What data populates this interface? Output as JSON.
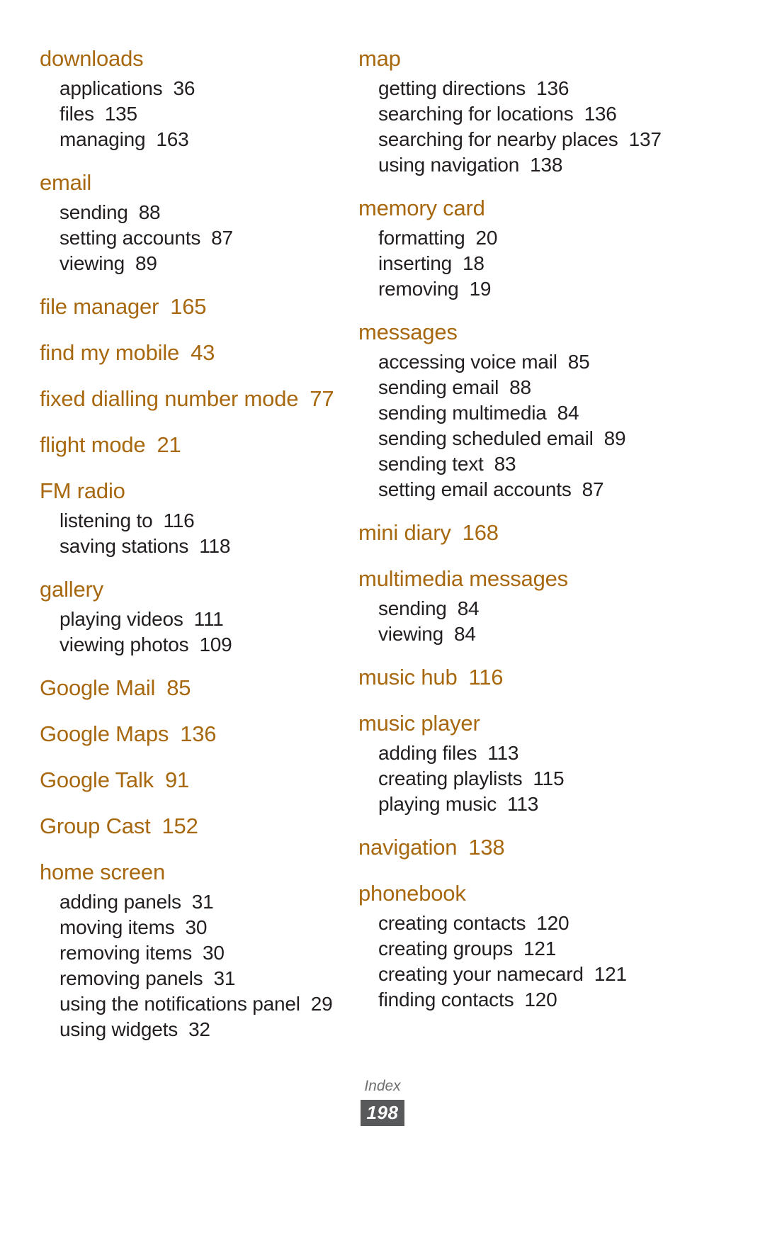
{
  "document": {
    "type": "index-page",
    "heading_color": "#a8680f",
    "body_color": "#231f20",
    "background": "#ffffff"
  },
  "footer": {
    "label": "Index",
    "page_number": "198",
    "badge_color": "#58595b",
    "label_color": "#6d6e70"
  },
  "columns": [
    {
      "name": "left-column",
      "groups": [
        {
          "heading": "downloads",
          "heading_page": "",
          "entries": [
            {
              "label": "applications",
              "page": "36"
            },
            {
              "label": "files",
              "page": "135"
            },
            {
              "label": "managing",
              "page": "163"
            }
          ]
        },
        {
          "heading": "email",
          "heading_page": "",
          "entries": [
            {
              "label": "sending",
              "page": "88"
            },
            {
              "label": "setting accounts",
              "page": "87"
            },
            {
              "label": "viewing",
              "page": "89"
            }
          ]
        },
        {
          "heading": "file manager",
          "heading_page": "165",
          "entries": []
        },
        {
          "heading": "find my mobile",
          "heading_page": "43",
          "entries": []
        },
        {
          "heading": "fixed dialling number mode",
          "heading_page": "77",
          "entries": []
        },
        {
          "heading": "flight mode",
          "heading_page": "21",
          "entries": []
        },
        {
          "heading": "FM radio",
          "heading_page": "",
          "entries": [
            {
              "label": "listening to",
              "page": "116"
            },
            {
              "label": "saving stations",
              "page": "118"
            }
          ]
        },
        {
          "heading": "gallery",
          "heading_page": "",
          "entries": [
            {
              "label": "playing videos",
              "page": "111"
            },
            {
              "label": "viewing photos",
              "page": "109"
            }
          ]
        },
        {
          "heading": "Google Mail",
          "heading_page": "85",
          "entries": []
        },
        {
          "heading": "Google Maps",
          "heading_page": "136",
          "entries": []
        },
        {
          "heading": "Google Talk",
          "heading_page": "91",
          "entries": []
        },
        {
          "heading": "Group Cast",
          "heading_page": "152",
          "entries": []
        },
        {
          "heading": "home screen",
          "heading_page": "",
          "entries": [
            {
              "label": "adding panels",
              "page": "31"
            },
            {
              "label": "moving items",
              "page": "30"
            },
            {
              "label": "removing items",
              "page": "30"
            },
            {
              "label": "removing panels",
              "page": "31"
            },
            {
              "label": "using the notifications panel",
              "page": "29"
            },
            {
              "label": "using widgets",
              "page": "32"
            }
          ]
        }
      ]
    },
    {
      "name": "right-column",
      "groups": [
        {
          "heading": "map",
          "heading_page": "",
          "entries": [
            {
              "label": "getting directions",
              "page": "136"
            },
            {
              "label": "searching for locations",
              "page": "136"
            },
            {
              "label": "searching for nearby places",
              "page": "137"
            },
            {
              "label": "using navigation",
              "page": "138"
            }
          ]
        },
        {
          "heading": "memory card",
          "heading_page": "",
          "entries": [
            {
              "label": "formatting",
              "page": "20"
            },
            {
              "label": "inserting",
              "page": "18"
            },
            {
              "label": "removing",
              "page": "19"
            }
          ]
        },
        {
          "heading": "messages",
          "heading_page": "",
          "entries": [
            {
              "label": "accessing voice mail",
              "page": "85"
            },
            {
              "label": "sending email",
              "page": "88"
            },
            {
              "label": "sending multimedia",
              "page": "84"
            },
            {
              "label": "sending scheduled email",
              "page": "89"
            },
            {
              "label": "sending text",
              "page": "83"
            },
            {
              "label": "setting email accounts",
              "page": "87"
            }
          ]
        },
        {
          "heading": "mini diary",
          "heading_page": "168",
          "entries": []
        },
        {
          "heading": "multimedia messages",
          "heading_page": "",
          "entries": [
            {
              "label": "sending",
              "page": "84"
            },
            {
              "label": "viewing",
              "page": "84"
            }
          ]
        },
        {
          "heading": "music hub",
          "heading_page": "116",
          "entries": []
        },
        {
          "heading": "music player",
          "heading_page": "",
          "entries": [
            {
              "label": "adding files",
              "page": "113"
            },
            {
              "label": "creating playlists",
              "page": "115"
            },
            {
              "label": "playing music",
              "page": "113"
            }
          ]
        },
        {
          "heading": "navigation",
          "heading_page": "138",
          "entries": []
        },
        {
          "heading": "phonebook",
          "heading_page": "",
          "entries": [
            {
              "label": "creating contacts",
              "page": "120"
            },
            {
              "label": "creating groups",
              "page": "121"
            },
            {
              "label": "creating your namecard",
              "page": "121"
            },
            {
              "label": "finding contacts",
              "page": "120"
            }
          ]
        }
      ]
    }
  ]
}
